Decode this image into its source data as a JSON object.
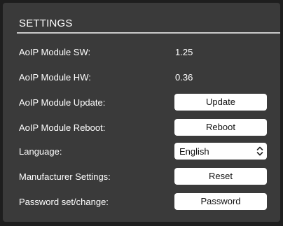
{
  "settings": {
    "title": "SETTINGS",
    "rows": [
      {
        "label": "AoIP Module SW:",
        "value": "1.25"
      },
      {
        "label": "AoIP Module HW:",
        "value": "0.36"
      },
      {
        "label": "AoIP Module Update:",
        "button": "Update"
      },
      {
        "label": "AoIP Module Reboot:",
        "button": "Reboot"
      },
      {
        "label": "Language:",
        "select": "English"
      },
      {
        "label": "Manufacturer Settings:",
        "button": "Reset"
      },
      {
        "label": "Password set/change:",
        "button": "Password"
      }
    ]
  },
  "icons": {
    "language_select": "chevron-up-down-icon"
  }
}
